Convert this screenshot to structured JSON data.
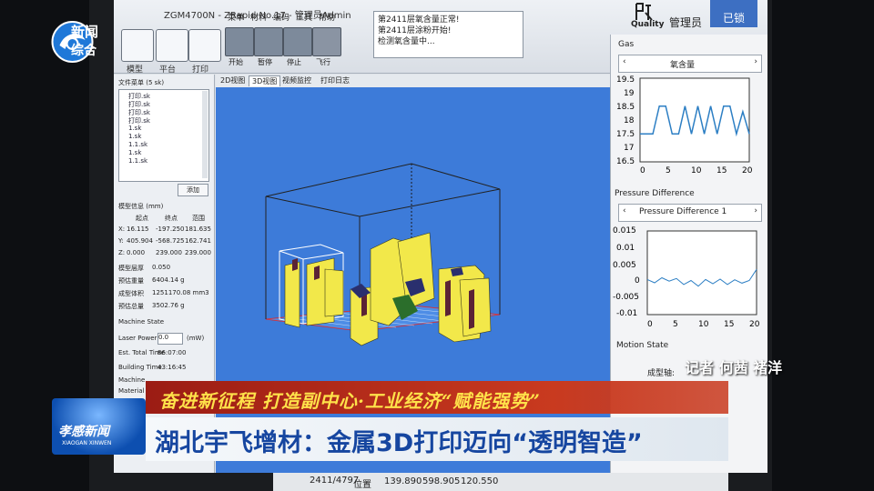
{
  "ribbon": {
    "title": "ZGM4700N - ZRapid No.17 - 管理员Admin",
    "tools": [
      {
        "label": "模型"
      },
      {
        "label": "平台"
      },
      {
        "label": "打印"
      }
    ],
    "menus": [
      "菜单",
      "材料",
      "编码",
      "工具",
      "帮助"
    ],
    "print_buttons": [
      {
        "label": "开始"
      },
      {
        "label": "暂停"
      },
      {
        "label": "停止"
      },
      {
        "label": "飞行"
      }
    ],
    "messages": [
      "第2411层氧含量正常!",
      "第2411层涂粉开始!",
      "检测氧含量中..."
    ],
    "quality_label": "Quality",
    "admin_label": "管理员",
    "lock_label": "已锁"
  },
  "left": {
    "file_title": "文件菜单 (5 sk)",
    "files": [
      "打印.sk",
      "打印.sk",
      "打印.sk",
      "打印.sk",
      "1.sk",
      "1.sk",
      "1.1.sk",
      "1.sk",
      "1.1.sk"
    ],
    "add_label": "添加",
    "print_header": "模型信息 (mm)",
    "grid_headers": [
      "起点",
      "终点",
      "范围"
    ],
    "rows": [
      {
        "k": "X:",
        "a": "16.115",
        "b": "-197.250",
        "c": "181.635"
      },
      {
        "k": "Y:",
        "a": "405.904",
        "b": "-568.725",
        "c": "162.741"
      },
      {
        "k": "Z:",
        "a": "0.000",
        "b": "239.000",
        "c": "239.000"
      }
    ],
    "info": [
      {
        "k": "模型层厚",
        "v": "0.050"
      },
      {
        "k": "预估重量",
        "v": "6404.14 g"
      },
      {
        "k": "成型体积",
        "v": "1251170.08 mm3"
      },
      {
        "k": "预估总量",
        "v": "3502.76 g"
      }
    ],
    "machine_state": "Machine State",
    "laser_power_label": "Laser Power",
    "laser_power_value": "0.0",
    "laser_unit": "(mW)",
    "est_time_label": "Est. Total Time",
    "est_time_value": "86:07:00",
    "building_label": "Building Time",
    "building_value": "43:16:45",
    "machine_label": "Machine",
    "material_label": "Material"
  },
  "tabs": [
    "2D视图",
    "3D视图",
    "视频监控",
    "打印日志"
  ],
  "graph": {
    "gas_title": "Gas",
    "oxygen_title": "氧含量",
    "oxy_y": [
      "19.5",
      "19",
      "18.5",
      "18",
      "17.5",
      "17",
      "16.5"
    ],
    "oxy_x": [
      "0",
      "5",
      "10",
      "15",
      "20"
    ],
    "pressure_title": "Pressure Difference",
    "pressure_series": "Pressure Difference 1",
    "pres_y": [
      "0.015",
      "0.01",
      "0.005",
      "0",
      "-0.005",
      "-0.01"
    ],
    "pres_x": [
      "0",
      "5",
      "10",
      "15",
      "20"
    ],
    "motion": "Motion State",
    "cut_label": "成型轴:"
  },
  "status": {
    "layer": "2411/4797",
    "pos_label": "位置",
    "x": "139.890",
    "y": "598.905",
    "z": "120.550"
  },
  "overlay": {
    "logo_line1": "新闻",
    "logo_line2": "综合",
    "reporter": "记者 何茜 褚洋",
    "band1": "奋进新征程 打造副中心·工业经济“赋能强势”",
    "band2": "湖北宇飞增材：金属3D打印迈向“透明智造”",
    "badge": "孝感新闻",
    "badge_sub": "XIAOGAN XINWEN"
  },
  "colors": {
    "viewport": "#3d7bd9",
    "model": "#f2e84a",
    "band_red": "#c93a1f",
    "band_text": "#ffe24a",
    "title_blue": "#1646a0"
  }
}
